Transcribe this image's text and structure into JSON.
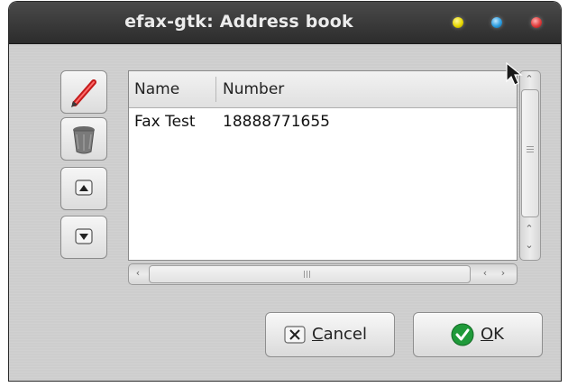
{
  "window": {
    "title": "efax-gtk: Address book"
  },
  "titlebar_controls": [
    {
      "name": "minimize",
      "color": "#e8d800"
    },
    {
      "name": "maximize",
      "color": "#2c9de0"
    },
    {
      "name": "close",
      "color": "#e03c3c"
    }
  ],
  "toolbar": {
    "buttons": [
      {
        "icon": "pencil-icon",
        "action": "edit"
      },
      {
        "icon": "trash-icon",
        "action": "delete"
      },
      {
        "icon": "arrow-up-icon",
        "action": "move-up"
      },
      {
        "icon": "arrow-down-icon",
        "action": "move-down"
      }
    ]
  },
  "table": {
    "columns": [
      "Name",
      "Number"
    ],
    "rows": [
      {
        "name": "Fax Test",
        "number": "18888771655"
      }
    ]
  },
  "dialog_buttons": {
    "cancel": {
      "mnemonic": "C",
      "rest": "ancel",
      "icon": "close-box-icon"
    },
    "ok": {
      "mnemonic": "O",
      "rest": "K",
      "icon": "checkmark-icon",
      "icon_color": "#1f9a3a"
    }
  }
}
